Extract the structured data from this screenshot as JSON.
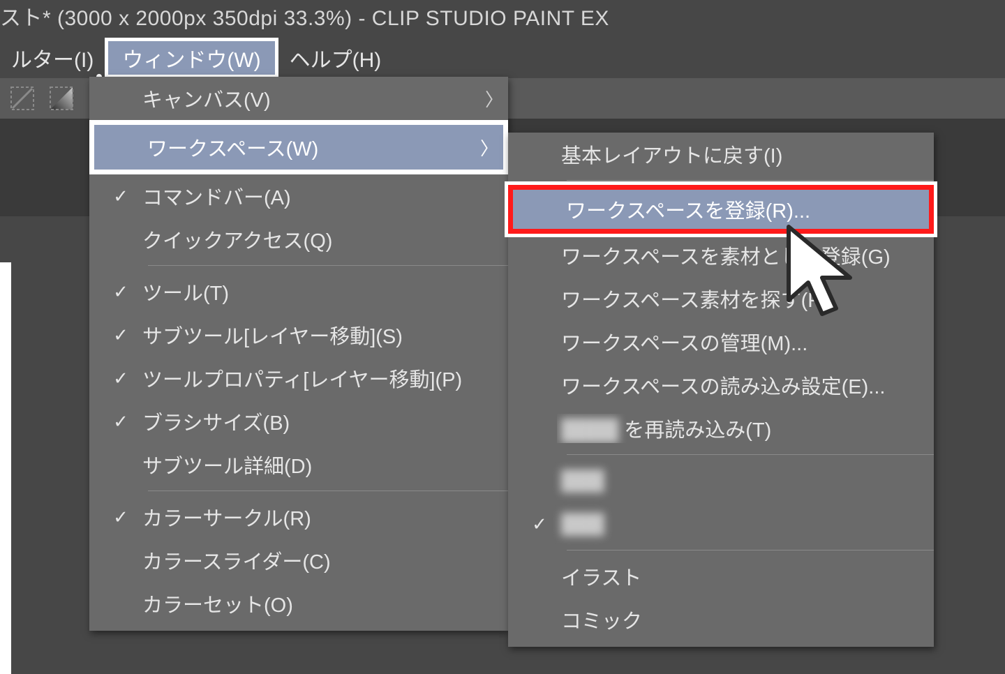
{
  "titlebar": "スト* (3000 x 2000px 350dpi 33.3%)  -  CLIP STUDIO PAINT EX",
  "menubar": {
    "filter": "ルター(I)",
    "window": "ウィンドウ(W)",
    "help": "ヘルプ(H)"
  },
  "window_menu": {
    "canvas": "キャンバス(V)",
    "workspace": "ワークスペース(W)",
    "command_bar": "コマンドバー(A)",
    "quick_access": "クイックアクセス(Q)",
    "tool": "ツール(T)",
    "subtool": "サブツール[レイヤー移動](S)",
    "tool_property": "ツールプロパティ[レイヤー移動](P)",
    "brush_size": "ブラシサイズ(B)",
    "subtool_detail": "サブツール詳細(D)",
    "color_circle": "カラーサークル(R)",
    "color_slider": "カラースライダー(C)",
    "color_set": "カラーセット(O)"
  },
  "workspace_submenu": {
    "reset_layout": "基本レイアウトに戻す(I)",
    "register": "ワークスペースを登録(R)...",
    "register_material": "ワークスペースを素材として登録(G)",
    "find_material": "ワークスペース素材を探す(F)",
    "manage": "ワークスペースの管理(M)...",
    "import_settings": "ワークスペースの読み込み設定(E)...",
    "reload_suffix": "を再読み込み(T)",
    "illust": "イラスト",
    "comic": "コミック"
  },
  "checks": {
    "command_bar": "✓",
    "tool": "✓",
    "subtool": "✓",
    "tool_property": "✓",
    "brush_size": "✓",
    "color_circle": "✓",
    "ws_item2": "✓"
  }
}
